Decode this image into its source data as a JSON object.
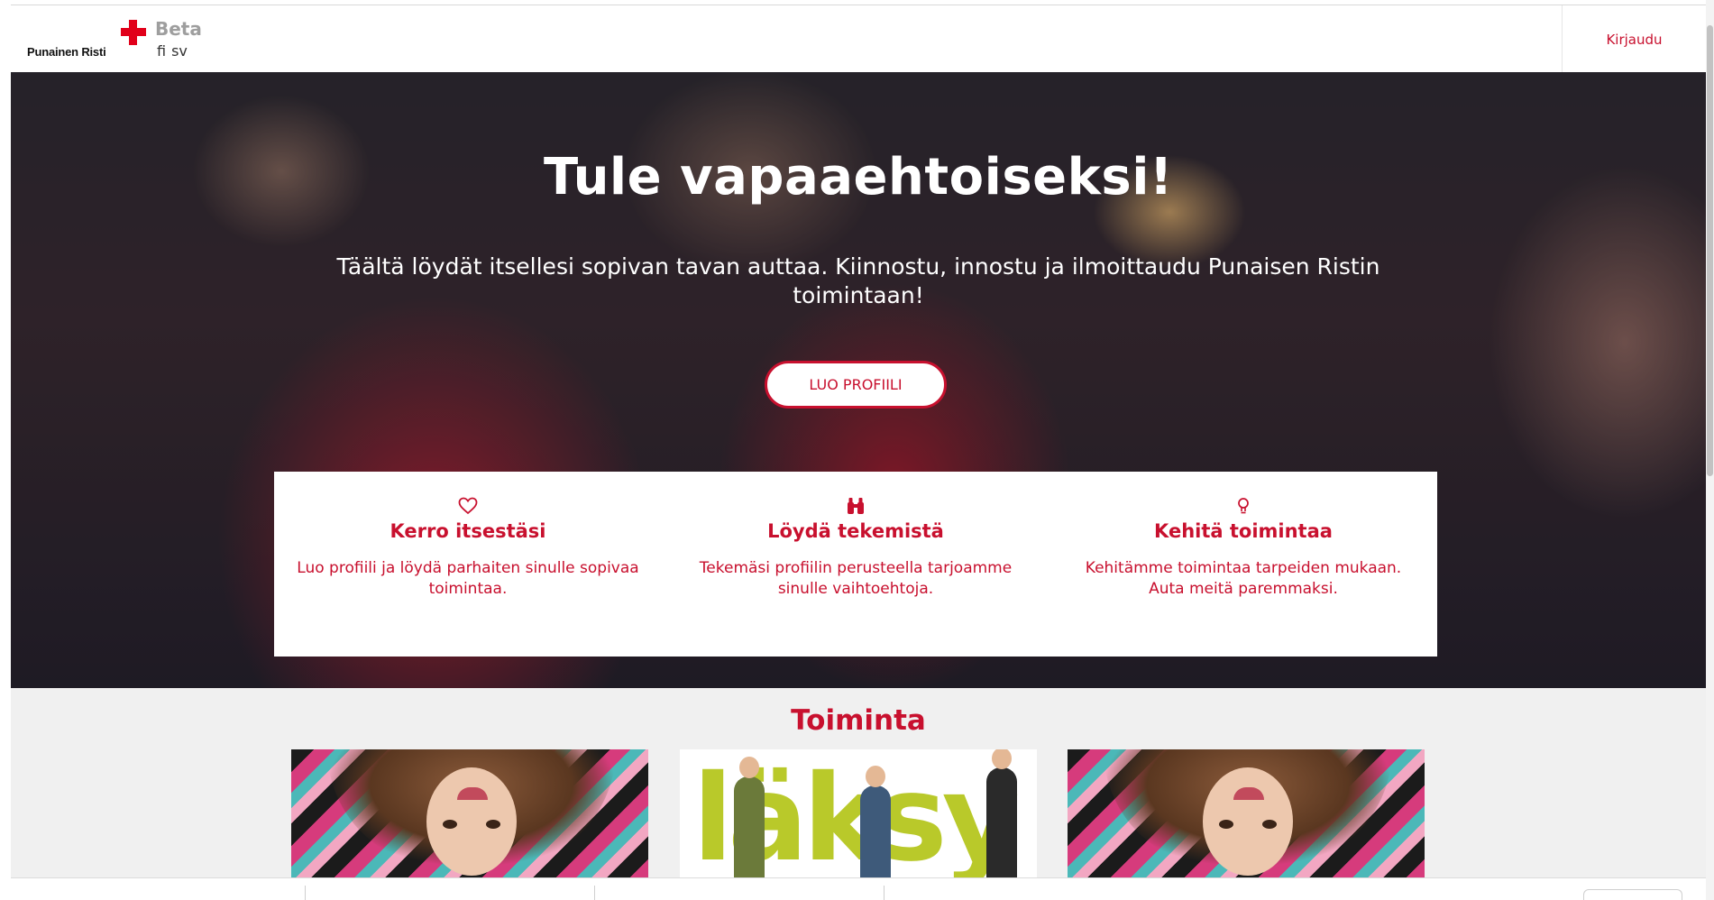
{
  "header": {
    "logo_text": "Punainen Risti",
    "beta_label": "Beta",
    "languages": [
      "fi",
      "sv"
    ],
    "login_label": "Kirjaudu"
  },
  "hero": {
    "title": "Tule vapaaehtoiseksi!",
    "subtitle": "Täältä löydät itsellesi sopivan tavan auttaa. Kiinnostu, innostu ja ilmoittaudu Punaisen Ristin toimintaan!",
    "cta_label": "LUO PROFIILI"
  },
  "features": [
    {
      "icon": "heart-icon",
      "title": "Kerro itsestäsi",
      "text": "Luo profiili ja löydä parhaiten sinulle sopivaa toimintaa."
    },
    {
      "icon": "binoculars-icon",
      "title": "Löydä tekemistä",
      "text": "Tekemäsi profiilin perusteella tarjoamme sinulle vaihtoehtoja."
    },
    {
      "icon": "lightbulb-icon",
      "title": "Kehitä toimintaa",
      "text": "Kehitämme toimintaa tarpeiden mukaan. Auta meitä paremmaksi."
    }
  ],
  "activities": {
    "title": "Toiminta",
    "card_laksy_text": "läksy"
  },
  "colors": {
    "brand_red": "#c8102e",
    "cross_red": "#e1001a",
    "section_bg": "#f0f0f0"
  }
}
